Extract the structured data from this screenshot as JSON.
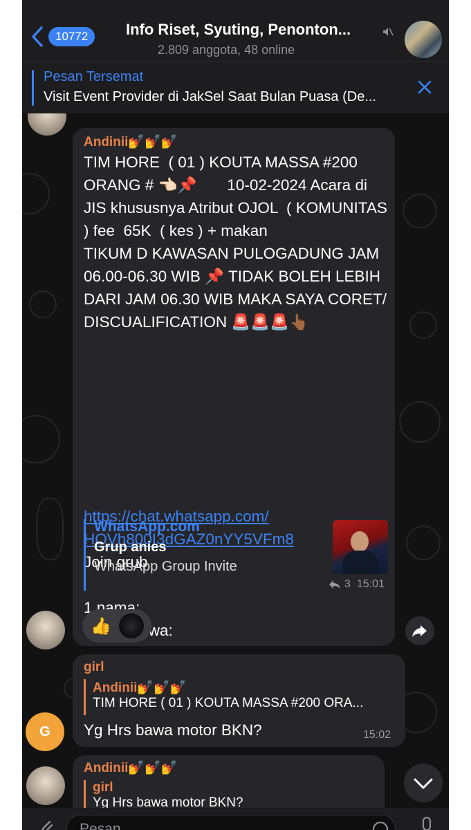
{
  "header": {
    "back_count": "10772",
    "title": "Info Riset, Syuting, Penonton...",
    "members": "2.809 anggota, 48 online"
  },
  "pinned": {
    "title": "Pesan Tersemat",
    "text": "Visit Event Provider di JakSel Saat Bulan Puasa (De..."
  },
  "message1": {
    "sender": "Andinii💅💅💅",
    "text": "TIM HORE  ( 01 ) KOUTA MASSA #200 ORANG # 👈🏻📌       10-02-2024 Acara di JIS khususnya Atribut OJOL  ( KOMUNITAS ) fee  65K  ( kes ) + makan                 TIKUM D KAWASAN PULOGADUNG JAM 06.00-06.30 WIB 📌 TIDAK BOLEH LEBIH DARI JAM 06.30 WIB MAKA SAYA CORET/ DISCUALIFICATION 🚨🚨🚨👆🏾",
    "link_line1": "https://chat.whatsapp.com/",
    "link_line2": "HOVh800I3dGAZ0nYY5VFm8",
    "join": "Join grub",
    "form_name": "1.nama:",
    "form_phone": "Nomor wa:",
    "preview_site": "WhatsApp.com",
    "preview_title": "Grup anies",
    "preview_desc": "WhatsApp Group Invite",
    "forwards": "3",
    "time": "15:01",
    "reaction": "👍"
  },
  "message2": {
    "sender": "girl",
    "reply_sender": "Andinii💅💅💅",
    "reply_text": "TIM HORE  ( 01 ) KOUTA MASSA #200 ORA...",
    "text": "Yg Hrs bawa motor BKN?",
    "time": "15:02",
    "avatar_letter": "G"
  },
  "message3": {
    "sender": "Andinii💅💅💅",
    "reply_sender": "girl",
    "reply_text": "Yg Hrs bawa motor BKN?"
  },
  "input": {
    "placeholder": "Pesan"
  },
  "colors": {
    "accent": "#3b82f6",
    "sender": "#e8814a",
    "bubble": "#26262a",
    "avatar_g": "#f2a33a"
  }
}
